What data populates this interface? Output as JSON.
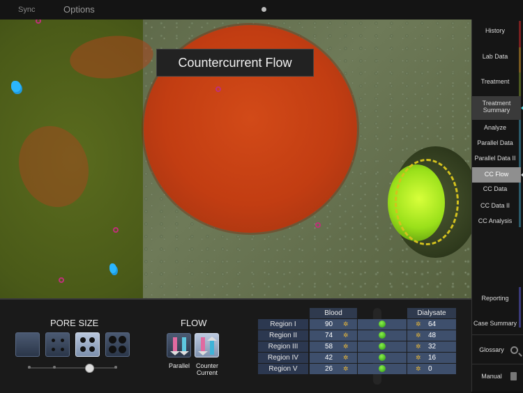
{
  "topbar": {
    "sync_label": "Sync",
    "options_label": "Options"
  },
  "scene": {
    "title": "Countercurrent Flow"
  },
  "sidebar": {
    "items": [
      {
        "label": "History",
        "bar_color": "#7a2020"
      },
      {
        "label": "Lab Data",
        "bar_color": "#7a5a20"
      },
      {
        "label": "Treatment",
        "bar_color": "#4e5a20"
      },
      {
        "label": "Treatment Summary",
        "bar_color": "#2a6a6a"
      },
      {
        "label": "Analyze",
        "bar_color": "#2a5a6a"
      },
      {
        "label": "Parallel Data",
        "bar_color": "#2a5a6a"
      },
      {
        "label": "Parallel Data II",
        "bar_color": "#2a5a6a"
      },
      {
        "label": "CC Flow",
        "bar_color": "#2a5a6a"
      },
      {
        "label": "CC Data",
        "bar_color": "#2a5a6a"
      },
      {
        "label": "CC Data II",
        "bar_color": "#2a5a6a"
      },
      {
        "label": "CC Analysis",
        "bar_color": "#2a5a6a"
      }
    ],
    "reporting": {
      "label": "Reporting"
    },
    "case_summary": {
      "label": "Case Summary"
    },
    "glossary": {
      "label": "Glossary"
    },
    "manual": {
      "label": "Manual"
    }
  },
  "panel": {
    "pore_size": {
      "title": "PORE SIZE",
      "options": 4,
      "selected_index": 2
    },
    "flow": {
      "title": "FLOW",
      "parallel_label": "Parallel",
      "counter_label_1": "Counter",
      "counter_label_2": "Current"
    },
    "table": {
      "blood_header": "Blood",
      "dialysate_header": "Dialysate",
      "rows": [
        {
          "region": "Region I",
          "blood": "90",
          "dialysate": "64"
        },
        {
          "region": "Region II",
          "blood": "74",
          "dialysate": "48"
        },
        {
          "region": "Region III",
          "blood": "58",
          "dialysate": "32"
        },
        {
          "region": "Region IV",
          "blood": "42",
          "dialysate": "16"
        },
        {
          "region": "Region V",
          "blood": "26",
          "dialysate": "0"
        }
      ]
    }
  },
  "colors": {
    "accent": "#54d3dc",
    "selected_nav": "#8f8f8f",
    "table_cell": "#3e4f6c"
  }
}
